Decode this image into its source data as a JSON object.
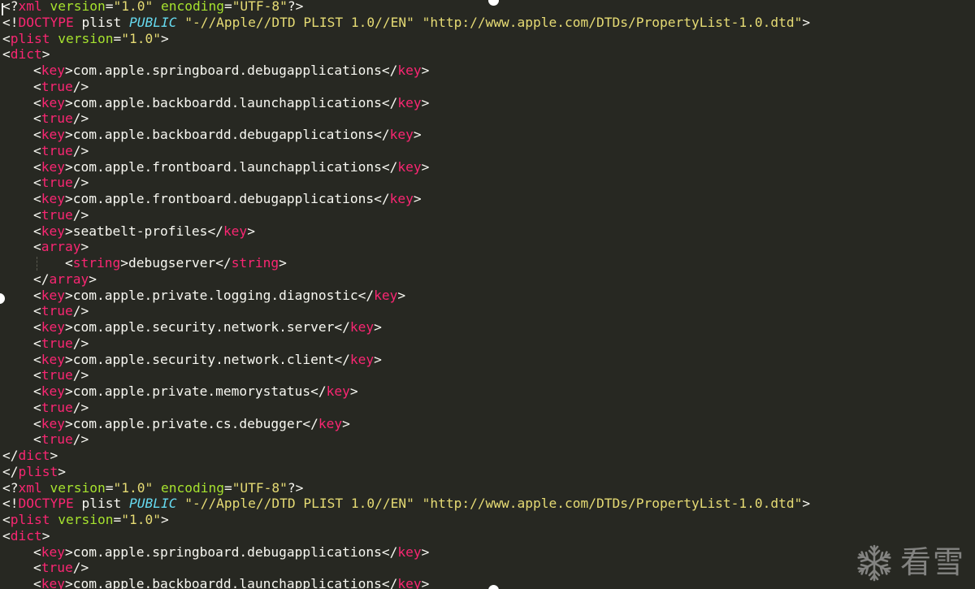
{
  "editor": {
    "lines": [
      {
        "indent": 0,
        "tokens": [
          [
            "punct",
            "<?"
          ],
          [
            "tag",
            "xml"
          ],
          [
            "text",
            " "
          ],
          [
            "attr",
            "version"
          ],
          [
            "punct",
            "="
          ],
          [
            "str",
            "\"1.0\""
          ],
          [
            "text",
            " "
          ],
          [
            "attr",
            "encoding"
          ],
          [
            "punct",
            "="
          ],
          [
            "str",
            "\"UTF-8\""
          ],
          [
            "punct",
            "?>"
          ]
        ]
      },
      {
        "indent": 0,
        "tokens": [
          [
            "punct",
            "<!"
          ],
          [
            "tag",
            "DOCTYPE"
          ],
          [
            "text",
            " plist "
          ],
          [
            "kw",
            "PUBLIC"
          ],
          [
            "text",
            " "
          ],
          [
            "str",
            "\"-//Apple//DTD PLIST 1.0//EN\""
          ],
          [
            "text",
            " "
          ],
          [
            "str",
            "\"http://www.apple.com/DTDs/PropertyList-1.0.dtd\""
          ],
          [
            "punct",
            ">"
          ]
        ]
      },
      {
        "indent": 0,
        "tokens": [
          [
            "punct",
            "<"
          ],
          [
            "tag",
            "plist"
          ],
          [
            "text",
            " "
          ],
          [
            "attr",
            "version"
          ],
          [
            "punct",
            "="
          ],
          [
            "str",
            "\"1.0\""
          ],
          [
            "punct",
            ">"
          ]
        ]
      },
      {
        "indent": 0,
        "tokens": [
          [
            "punct",
            "<"
          ],
          [
            "tag",
            "dict"
          ],
          [
            "punct",
            ">"
          ]
        ]
      },
      {
        "indent": 1,
        "tokens": [
          [
            "punct",
            "<"
          ],
          [
            "tag",
            "key"
          ],
          [
            "punct",
            ">"
          ],
          [
            "text",
            "com.apple.springboard.debugapplications"
          ],
          [
            "punct",
            "</"
          ],
          [
            "tag",
            "key"
          ],
          [
            "punct",
            ">"
          ]
        ]
      },
      {
        "indent": 1,
        "tokens": [
          [
            "punct",
            "<"
          ],
          [
            "tag",
            "true"
          ],
          [
            "punct",
            "/>"
          ]
        ]
      },
      {
        "indent": 1,
        "tokens": [
          [
            "punct",
            "<"
          ],
          [
            "tag",
            "key"
          ],
          [
            "punct",
            ">"
          ],
          [
            "text",
            "com.apple.backboardd.launchapplications"
          ],
          [
            "punct",
            "</"
          ],
          [
            "tag",
            "key"
          ],
          [
            "punct",
            ">"
          ]
        ]
      },
      {
        "indent": 1,
        "tokens": [
          [
            "punct",
            "<"
          ],
          [
            "tag",
            "true"
          ],
          [
            "punct",
            "/>"
          ]
        ]
      },
      {
        "indent": 1,
        "tokens": [
          [
            "punct",
            "<"
          ],
          [
            "tag",
            "key"
          ],
          [
            "punct",
            ">"
          ],
          [
            "text",
            "com.apple.backboardd.debugapplications"
          ],
          [
            "punct",
            "</"
          ],
          [
            "tag",
            "key"
          ],
          [
            "punct",
            ">"
          ]
        ]
      },
      {
        "indent": 1,
        "tokens": [
          [
            "punct",
            "<"
          ],
          [
            "tag",
            "true"
          ],
          [
            "punct",
            "/>"
          ]
        ]
      },
      {
        "indent": 1,
        "tokens": [
          [
            "punct",
            "<"
          ],
          [
            "tag",
            "key"
          ],
          [
            "punct",
            ">"
          ],
          [
            "text",
            "com.apple.frontboard.launchapplications"
          ],
          [
            "punct",
            "</"
          ],
          [
            "tag",
            "key"
          ],
          [
            "punct",
            ">"
          ]
        ]
      },
      {
        "indent": 1,
        "tokens": [
          [
            "punct",
            "<"
          ],
          [
            "tag",
            "true"
          ],
          [
            "punct",
            "/>"
          ]
        ]
      },
      {
        "indent": 1,
        "tokens": [
          [
            "punct",
            "<"
          ],
          [
            "tag",
            "key"
          ],
          [
            "punct",
            ">"
          ],
          [
            "text",
            "com.apple.frontboard.debugapplications"
          ],
          [
            "punct",
            "</"
          ],
          [
            "tag",
            "key"
          ],
          [
            "punct",
            ">"
          ]
        ]
      },
      {
        "indent": 1,
        "tokens": [
          [
            "punct",
            "<"
          ],
          [
            "tag",
            "true"
          ],
          [
            "punct",
            "/>"
          ]
        ]
      },
      {
        "indent": 1,
        "tokens": [
          [
            "punct",
            "<"
          ],
          [
            "tag",
            "key"
          ],
          [
            "punct",
            ">"
          ],
          [
            "text",
            "seatbelt-profiles"
          ],
          [
            "punct",
            "</"
          ],
          [
            "tag",
            "key"
          ],
          [
            "punct",
            ">"
          ]
        ]
      },
      {
        "indent": 1,
        "tokens": [
          [
            "punct",
            "<"
          ],
          [
            "tag",
            "array"
          ],
          [
            "punct",
            ">"
          ]
        ]
      },
      {
        "indent": 2,
        "guide": true,
        "tokens": [
          [
            "punct",
            "<"
          ],
          [
            "tag",
            "string"
          ],
          [
            "punct",
            ">"
          ],
          [
            "text",
            "debugserver"
          ],
          [
            "punct",
            "</"
          ],
          [
            "tag",
            "string"
          ],
          [
            "punct",
            ">"
          ]
        ]
      },
      {
        "indent": 1,
        "tokens": [
          [
            "punct",
            "</"
          ],
          [
            "tag",
            "array"
          ],
          [
            "punct",
            ">"
          ]
        ]
      },
      {
        "indent": 1,
        "tokens": [
          [
            "punct",
            "<"
          ],
          [
            "tag",
            "key"
          ],
          [
            "punct",
            ">"
          ],
          [
            "text",
            "com.apple.private.logging.diagnostic"
          ],
          [
            "punct",
            "</"
          ],
          [
            "tag",
            "key"
          ],
          [
            "punct",
            ">"
          ]
        ]
      },
      {
        "indent": 1,
        "tokens": [
          [
            "punct",
            "<"
          ],
          [
            "tag",
            "true"
          ],
          [
            "punct",
            "/>"
          ]
        ]
      },
      {
        "indent": 1,
        "tokens": [
          [
            "punct",
            "<"
          ],
          [
            "tag",
            "key"
          ],
          [
            "punct",
            ">"
          ],
          [
            "text",
            "com.apple.security.network.server"
          ],
          [
            "punct",
            "</"
          ],
          [
            "tag",
            "key"
          ],
          [
            "punct",
            ">"
          ]
        ]
      },
      {
        "indent": 1,
        "tokens": [
          [
            "punct",
            "<"
          ],
          [
            "tag",
            "true"
          ],
          [
            "punct",
            "/>"
          ]
        ]
      },
      {
        "indent": 1,
        "tokens": [
          [
            "punct",
            "<"
          ],
          [
            "tag",
            "key"
          ],
          [
            "punct",
            ">"
          ],
          [
            "text",
            "com.apple.security.network.client"
          ],
          [
            "punct",
            "</"
          ],
          [
            "tag",
            "key"
          ],
          [
            "punct",
            ">"
          ]
        ]
      },
      {
        "indent": 1,
        "tokens": [
          [
            "punct",
            "<"
          ],
          [
            "tag",
            "true"
          ],
          [
            "punct",
            "/>"
          ]
        ]
      },
      {
        "indent": 1,
        "tokens": [
          [
            "punct",
            "<"
          ],
          [
            "tag",
            "key"
          ],
          [
            "punct",
            ">"
          ],
          [
            "text",
            "com.apple.private.memorystatus"
          ],
          [
            "punct",
            "</"
          ],
          [
            "tag",
            "key"
          ],
          [
            "punct",
            ">"
          ]
        ]
      },
      {
        "indent": 1,
        "tokens": [
          [
            "punct",
            "<"
          ],
          [
            "tag",
            "true"
          ],
          [
            "punct",
            "/>"
          ]
        ]
      },
      {
        "indent": 1,
        "tokens": [
          [
            "punct",
            "<"
          ],
          [
            "tag",
            "key"
          ],
          [
            "punct",
            ">"
          ],
          [
            "text",
            "com.apple.private.cs.debugger"
          ],
          [
            "punct",
            "</"
          ],
          [
            "tag",
            "key"
          ],
          [
            "punct",
            ">"
          ]
        ]
      },
      {
        "indent": 1,
        "tokens": [
          [
            "punct",
            "<"
          ],
          [
            "tag",
            "true"
          ],
          [
            "punct",
            "/>"
          ]
        ]
      },
      {
        "indent": 0,
        "tokens": [
          [
            "punct",
            "</"
          ],
          [
            "tag",
            "dict"
          ],
          [
            "punct",
            ">"
          ]
        ]
      },
      {
        "indent": 0,
        "tokens": [
          [
            "punct",
            "</"
          ],
          [
            "tag",
            "plist"
          ],
          [
            "punct",
            ">"
          ]
        ]
      },
      {
        "indent": 0,
        "tokens": [
          [
            "punct",
            "<?"
          ],
          [
            "tag",
            "xml"
          ],
          [
            "text",
            " "
          ],
          [
            "attr",
            "version"
          ],
          [
            "punct",
            "="
          ],
          [
            "str",
            "\"1.0\""
          ],
          [
            "text",
            " "
          ],
          [
            "attr",
            "encoding"
          ],
          [
            "punct",
            "="
          ],
          [
            "str",
            "\"UTF-8\""
          ],
          [
            "punct",
            "?>"
          ]
        ]
      },
      {
        "indent": 0,
        "tokens": [
          [
            "punct",
            "<!"
          ],
          [
            "tag",
            "DOCTYPE"
          ],
          [
            "text",
            " plist "
          ],
          [
            "kw",
            "PUBLIC"
          ],
          [
            "text",
            " "
          ],
          [
            "str",
            "\"-//Apple//DTD PLIST 1.0//EN\""
          ],
          [
            "text",
            " "
          ],
          [
            "str",
            "\"http://www.apple.com/DTDs/PropertyList-1.0.dtd\""
          ],
          [
            "punct",
            ">"
          ]
        ]
      },
      {
        "indent": 0,
        "tokens": [
          [
            "punct",
            "<"
          ],
          [
            "tag",
            "plist"
          ],
          [
            "text",
            " "
          ],
          [
            "attr",
            "version"
          ],
          [
            "punct",
            "="
          ],
          [
            "str",
            "\"1.0\""
          ],
          [
            "punct",
            ">"
          ]
        ]
      },
      {
        "indent": 0,
        "tokens": [
          [
            "punct",
            "<"
          ],
          [
            "tag",
            "dict"
          ],
          [
            "punct",
            ">"
          ]
        ]
      },
      {
        "indent": 1,
        "tokens": [
          [
            "punct",
            "<"
          ],
          [
            "tag",
            "key"
          ],
          [
            "punct",
            ">"
          ],
          [
            "text",
            "com.apple.springboard.debugapplications"
          ],
          [
            "punct",
            "</"
          ],
          [
            "tag",
            "key"
          ],
          [
            "punct",
            ">"
          ]
        ]
      },
      {
        "indent": 1,
        "tokens": [
          [
            "punct",
            "<"
          ],
          [
            "tag",
            "true"
          ],
          [
            "punct",
            "/>"
          ]
        ]
      },
      {
        "indent": 1,
        "tokens": [
          [
            "punct",
            "<"
          ],
          [
            "tag",
            "key"
          ],
          [
            "punct",
            ">"
          ],
          [
            "text",
            "com.apple.backboardd.launchapplications"
          ],
          [
            "punct",
            "</"
          ],
          [
            "tag",
            "key"
          ],
          [
            "punct",
            ">"
          ]
        ]
      }
    ]
  },
  "colors": {
    "background": "#272822",
    "punctuation": "#f8f8f2",
    "tag": "#f92672",
    "attribute": "#a6e22e",
    "string": "#e6db74",
    "keyword": "#66d9ef",
    "text": "#f8f8f2"
  },
  "watermark": {
    "icon": "snowflake-icon",
    "text": "看雪"
  }
}
